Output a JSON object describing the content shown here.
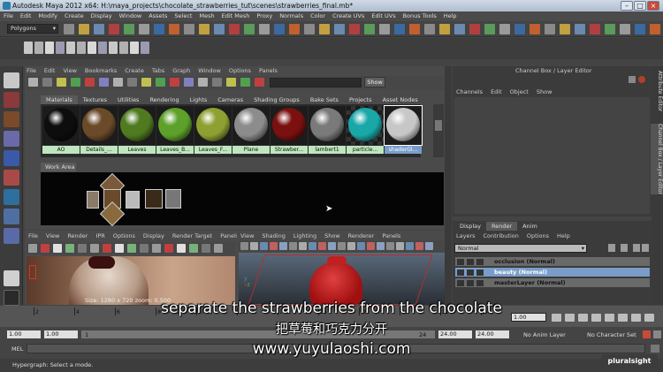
{
  "window": {
    "title": "Autodesk Maya 2012 x64: H:\\maya_projects\\chocolate_strawberries_tut\\scenes\\strawberries_final.mb*",
    "controls": [
      "–",
      "□",
      "×"
    ]
  },
  "menubar": [
    "File",
    "Edit",
    "Modify",
    "Create",
    "Display",
    "Window",
    "Assets",
    "Select",
    "Mesh",
    "Edit Mesh",
    "Proxy",
    "Normals",
    "Color",
    "Create UVs",
    "Edit UVs",
    "Bonus Tools",
    "Help"
  ],
  "status_line": {
    "menuset": "Polygons"
  },
  "hypershade": {
    "menu": [
      "File",
      "Edit",
      "View",
      "Bookmarks",
      "Create",
      "Tabs",
      "Graph",
      "Window",
      "Options",
      "Panels"
    ],
    "show_button": "Show",
    "tabs": [
      "Materials",
      "Textures",
      "Utilities",
      "Rendering",
      "Lights",
      "Cameras",
      "Shading Groups",
      "Bake Sets",
      "Projects",
      "Asset Nodes"
    ],
    "active_tab": "Materials",
    "materials": [
      {
        "name": "AO",
        "color": "#0d0d0d",
        "selected": false
      },
      {
        "name": "Details_...",
        "color": "#6b4a2a",
        "selected": false
      },
      {
        "name": "Leaves",
        "color": "#4f7a1f",
        "selected": false
      },
      {
        "name": "Leaves_B...",
        "color": "#5da12a",
        "selected": false
      },
      {
        "name": "Leaves_F...",
        "color": "#8fa032",
        "selected": false
      },
      {
        "name": "Plane",
        "color": "#8c8c8c",
        "selected": false
      },
      {
        "name": "Strawber...",
        "color": "#7a1010",
        "selected": false
      },
      {
        "name": "lambert1",
        "color": "#7a7a7a",
        "selected": false
      },
      {
        "name": "particle...",
        "color": "#1aa7a7",
        "selected": false
      },
      {
        "name": "shaderGl...",
        "color": "#c7c7c7",
        "selected": true
      }
    ],
    "work_area_tab": "Work Area"
  },
  "viewport_render": {
    "menu": [
      "File",
      "View",
      "Render",
      "IPR",
      "Options",
      "Display",
      "Render Target",
      "Panels"
    ],
    "overlay": "Size: 1280 x 720 zoom: 0.500"
  },
  "viewport_persp": {
    "menu": [
      "View",
      "Shading",
      "Lighting",
      "Show",
      "Renderer",
      "Panels"
    ]
  },
  "channel_box": {
    "header": "Channel Box / Layer Editor",
    "menu": [
      "Channels",
      "Edit",
      "Object",
      "Show"
    ],
    "side_tabs": [
      "Attribute Editor",
      "Channel Box / Layer Editor"
    ]
  },
  "layer_editor": {
    "tabs": [
      "Display",
      "Render",
      "Anim"
    ],
    "active_tab": "Render",
    "menu": [
      "Layers",
      "Contribution",
      "Options",
      "Help"
    ],
    "mode": "Normal",
    "layers": [
      {
        "name": "occlusion (Normal)",
        "selected": false
      },
      {
        "name": "beauty (Normal)",
        "selected": true
      },
      {
        "name": "masterLayer (Normal)",
        "selected": false
      }
    ]
  },
  "timeline": {
    "ticks": [
      "2",
      "4",
      "6",
      "8",
      "10",
      "12",
      "14",
      "16",
      "18",
      "20",
      "22",
      "24"
    ],
    "current_frame": "1.00"
  },
  "range": {
    "start": "1.00",
    "start2": "1.00",
    "start3": "1",
    "end": "24",
    "end2": "24.00",
    "end3": "24.00",
    "anim_layer": "No Anim Layer",
    "character_set": "No Character Set"
  },
  "command_line": {
    "label": "MEL"
  },
  "help_line": "Hypergraph: Select a mode.",
  "subtitles": {
    "english": "separate the strawberries from the chocolate",
    "chinese": "把草莓和巧克力分开",
    "site": "www.yuyulaoshi.com"
  },
  "watermark": "pluralsight",
  "colors": {
    "selected_blue": "#7a9cc8",
    "green_label": "#bfe6bf",
    "maya_red": "#d23030"
  }
}
